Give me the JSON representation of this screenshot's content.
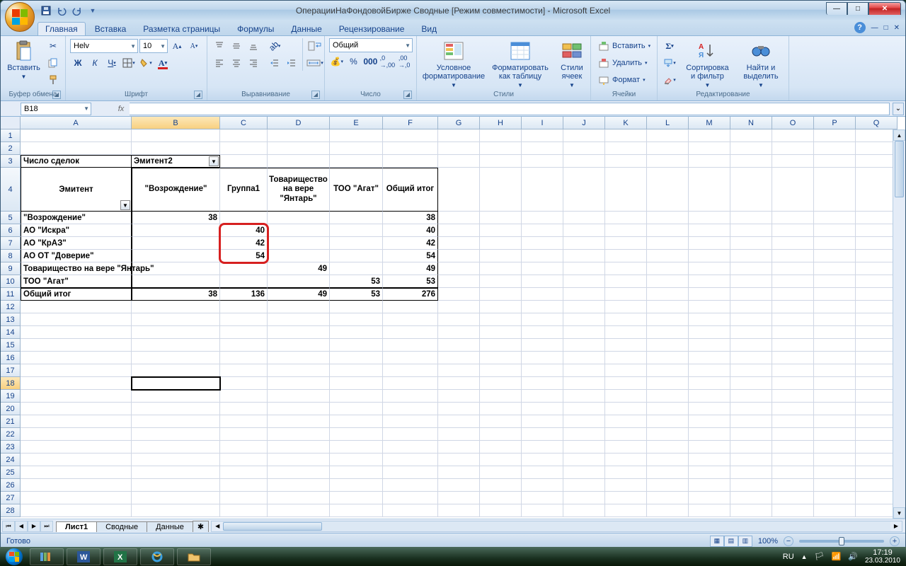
{
  "title": "ОперацииНаФондовойБирже  Сводные  [Режим совместимости] - Microsoft Excel",
  "tabs": [
    "Главная",
    "Вставка",
    "Разметка страницы",
    "Формулы",
    "Данные",
    "Рецензирование",
    "Вид"
  ],
  "active_tab": 0,
  "groups": {
    "clipboard": {
      "paste": "Вставить",
      "label": "Буфер обмена"
    },
    "font": {
      "name": "Helv",
      "size": "10",
      "label": "Шрифт"
    },
    "align": {
      "label": "Выравнивание"
    },
    "number": {
      "format": "Общий",
      "label": "Число"
    },
    "styles": {
      "cond": "Условное форматирование",
      "table": "Форматировать как таблицу",
      "cell": "Стили ячеек",
      "label": "Стили"
    },
    "cells": {
      "insert": "Вставить",
      "delete": "Удалить",
      "format": "Формат",
      "label": "Ячейки"
    },
    "editing": {
      "sort": "Сортировка и фильтр",
      "find": "Найти и выделить",
      "label": "Редактирование"
    }
  },
  "namebox": "B18",
  "columns": [
    "A",
    "B",
    "C",
    "D",
    "E",
    "F",
    "G",
    "H",
    "I",
    "J",
    "K",
    "L",
    "M",
    "N",
    "O",
    "P",
    "Q"
  ],
  "col_widths": {
    "A": 157,
    "B": 125,
    "C": 67,
    "D": 88,
    "E": 75,
    "F": 78,
    "default": 59
  },
  "row_heights": {
    "4": 62,
    "default": 18
  },
  "rows_shown": 28,
  "selected_cell": "B18",
  "pivot": {
    "filter_label": "Число сделок",
    "col_field": "Эмитент2",
    "row_field": "Эмитент",
    "col_headers": [
      "\"Возрождение\"",
      "Группа1",
      "Товарищество на вере \"Янтарь\"",
      "ТОО \"Агат\"",
      "Общий итог"
    ],
    "rows": [
      {
        "label": "\"Возрождение\"",
        "vals": [
          "38",
          "",
          "",
          "",
          "38"
        ]
      },
      {
        "label": "АО \"Искра\"",
        "vals": [
          "",
          "40",
          "",
          "",
          "40"
        ]
      },
      {
        "label": "АО \"КрАЗ\"",
        "vals": [
          "",
          "42",
          "",
          "",
          "42"
        ]
      },
      {
        "label": "АО ОТ \"Доверие\"",
        "vals": [
          "",
          "54",
          "",
          "",
          "54"
        ]
      },
      {
        "label": "Товарищество на вере \"Янтарь\"",
        "vals": [
          "",
          "",
          "49",
          "",
          "49"
        ]
      },
      {
        "label": "ТОО \"Агат\"",
        "vals": [
          "",
          "",
          "",
          "53",
          "53"
        ]
      },
      {
        "label": "Общий итог",
        "vals": [
          "38",
          "136",
          "49",
          "53",
          "276"
        ]
      }
    ]
  },
  "sheets": [
    "Лист1",
    "Сводные",
    "Данные"
  ],
  "active_sheet": 0,
  "status": "Готово",
  "zoom": "100%",
  "tray": {
    "lang": "RU",
    "time": "17:19",
    "date": "23.03.2010"
  }
}
